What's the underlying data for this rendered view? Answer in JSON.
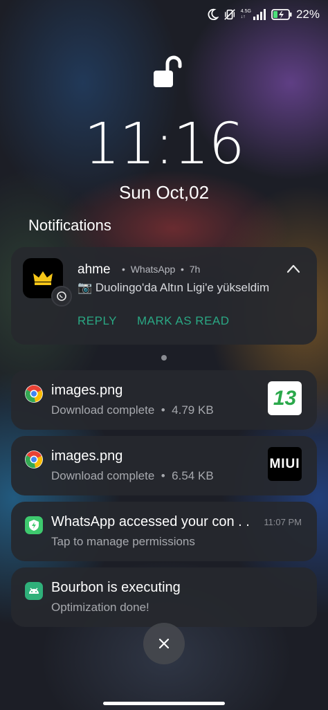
{
  "status_bar": {
    "network_type": "4.5G",
    "battery_percent": "22%",
    "icons": [
      "moon-icon",
      "vibrate-off-icon",
      "signal-icon",
      "battery-charging-icon"
    ]
  },
  "lockscreen": {
    "time": "11:16",
    "date": "Sun Oct,02",
    "section_title": "Notifications"
  },
  "whatsapp_notification": {
    "sender": "ahme",
    "app": "WhatsApp",
    "age": "7h",
    "message": "📷 Duolingo'da Altın Ligi'e yükseldim",
    "actions": [
      "REPLY",
      "MARK AS READ"
    ]
  },
  "notifications": [
    {
      "title": "images.png",
      "subtitle": "Download complete",
      "size": "4.79 KB",
      "icon": "chrome-icon",
      "thumbnail_text": "13"
    },
    {
      "title": "images.png",
      "subtitle": "Download complete",
      "size": "6.54 KB",
      "icon": "chrome-icon",
      "thumbnail_text": "MIUI"
    },
    {
      "title": "WhatsApp accessed your con . .",
      "subtitle": "Tap to manage permissions",
      "time": "11:07 PM",
      "icon": "shield-bolt-icon"
    },
    {
      "title": "Bourbon is executing",
      "subtitle": "Optimization done!",
      "icon": "android-icon"
    }
  ],
  "colors": {
    "accent_green": "#2aa884",
    "card_bg": "#26282e"
  }
}
